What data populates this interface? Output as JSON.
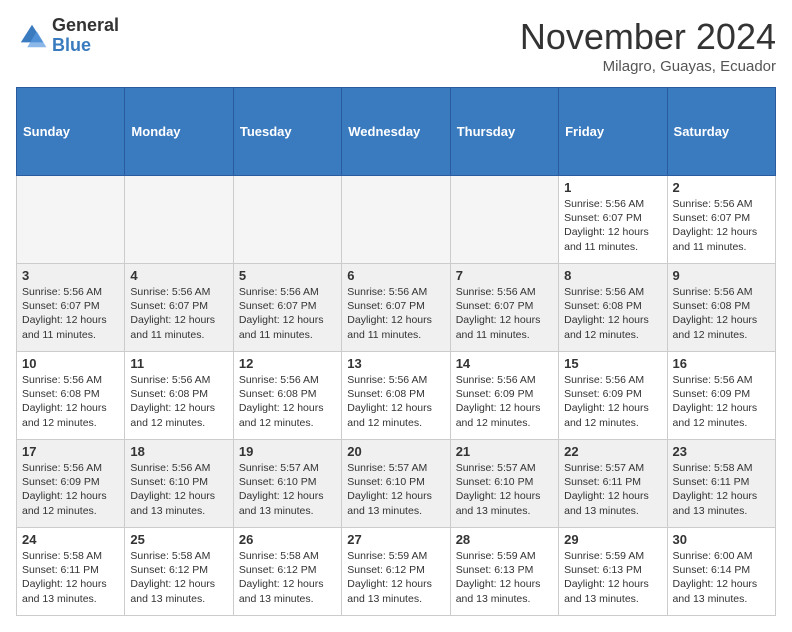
{
  "header": {
    "logo_general": "General",
    "logo_blue": "Blue",
    "month_title": "November 2024",
    "location": "Milagro, Guayas, Ecuador"
  },
  "weekdays": [
    "Sunday",
    "Monday",
    "Tuesday",
    "Wednesday",
    "Thursday",
    "Friday",
    "Saturday"
  ],
  "weeks": [
    [
      {
        "day": "",
        "info": ""
      },
      {
        "day": "",
        "info": ""
      },
      {
        "day": "",
        "info": ""
      },
      {
        "day": "",
        "info": ""
      },
      {
        "day": "",
        "info": ""
      },
      {
        "day": "1",
        "info": "Sunrise: 5:56 AM\nSunset: 6:07 PM\nDaylight: 12 hours\nand 11 minutes."
      },
      {
        "day": "2",
        "info": "Sunrise: 5:56 AM\nSunset: 6:07 PM\nDaylight: 12 hours\nand 11 minutes."
      }
    ],
    [
      {
        "day": "3",
        "info": "Sunrise: 5:56 AM\nSunset: 6:07 PM\nDaylight: 12 hours\nand 11 minutes."
      },
      {
        "day": "4",
        "info": "Sunrise: 5:56 AM\nSunset: 6:07 PM\nDaylight: 12 hours\nand 11 minutes."
      },
      {
        "day": "5",
        "info": "Sunrise: 5:56 AM\nSunset: 6:07 PM\nDaylight: 12 hours\nand 11 minutes."
      },
      {
        "day": "6",
        "info": "Sunrise: 5:56 AM\nSunset: 6:07 PM\nDaylight: 12 hours\nand 11 minutes."
      },
      {
        "day": "7",
        "info": "Sunrise: 5:56 AM\nSunset: 6:07 PM\nDaylight: 12 hours\nand 11 minutes."
      },
      {
        "day": "8",
        "info": "Sunrise: 5:56 AM\nSunset: 6:08 PM\nDaylight: 12 hours\nand 12 minutes."
      },
      {
        "day": "9",
        "info": "Sunrise: 5:56 AM\nSunset: 6:08 PM\nDaylight: 12 hours\nand 12 minutes."
      }
    ],
    [
      {
        "day": "10",
        "info": "Sunrise: 5:56 AM\nSunset: 6:08 PM\nDaylight: 12 hours\nand 12 minutes."
      },
      {
        "day": "11",
        "info": "Sunrise: 5:56 AM\nSunset: 6:08 PM\nDaylight: 12 hours\nand 12 minutes."
      },
      {
        "day": "12",
        "info": "Sunrise: 5:56 AM\nSunset: 6:08 PM\nDaylight: 12 hours\nand 12 minutes."
      },
      {
        "day": "13",
        "info": "Sunrise: 5:56 AM\nSunset: 6:08 PM\nDaylight: 12 hours\nand 12 minutes."
      },
      {
        "day": "14",
        "info": "Sunrise: 5:56 AM\nSunset: 6:09 PM\nDaylight: 12 hours\nand 12 minutes."
      },
      {
        "day": "15",
        "info": "Sunrise: 5:56 AM\nSunset: 6:09 PM\nDaylight: 12 hours\nand 12 minutes."
      },
      {
        "day": "16",
        "info": "Sunrise: 5:56 AM\nSunset: 6:09 PM\nDaylight: 12 hours\nand 12 minutes."
      }
    ],
    [
      {
        "day": "17",
        "info": "Sunrise: 5:56 AM\nSunset: 6:09 PM\nDaylight: 12 hours\nand 12 minutes."
      },
      {
        "day": "18",
        "info": "Sunrise: 5:56 AM\nSunset: 6:10 PM\nDaylight: 12 hours\nand 13 minutes."
      },
      {
        "day": "19",
        "info": "Sunrise: 5:57 AM\nSunset: 6:10 PM\nDaylight: 12 hours\nand 13 minutes."
      },
      {
        "day": "20",
        "info": "Sunrise: 5:57 AM\nSunset: 6:10 PM\nDaylight: 12 hours\nand 13 minutes."
      },
      {
        "day": "21",
        "info": "Sunrise: 5:57 AM\nSunset: 6:10 PM\nDaylight: 12 hours\nand 13 minutes."
      },
      {
        "day": "22",
        "info": "Sunrise: 5:57 AM\nSunset: 6:11 PM\nDaylight: 12 hours\nand 13 minutes."
      },
      {
        "day": "23",
        "info": "Sunrise: 5:58 AM\nSunset: 6:11 PM\nDaylight: 12 hours\nand 13 minutes."
      }
    ],
    [
      {
        "day": "24",
        "info": "Sunrise: 5:58 AM\nSunset: 6:11 PM\nDaylight: 12 hours\nand 13 minutes."
      },
      {
        "day": "25",
        "info": "Sunrise: 5:58 AM\nSunset: 6:12 PM\nDaylight: 12 hours\nand 13 minutes."
      },
      {
        "day": "26",
        "info": "Sunrise: 5:58 AM\nSunset: 6:12 PM\nDaylight: 12 hours\nand 13 minutes."
      },
      {
        "day": "27",
        "info": "Sunrise: 5:59 AM\nSunset: 6:12 PM\nDaylight: 12 hours\nand 13 minutes."
      },
      {
        "day": "28",
        "info": "Sunrise: 5:59 AM\nSunset: 6:13 PM\nDaylight: 12 hours\nand 13 minutes."
      },
      {
        "day": "29",
        "info": "Sunrise: 5:59 AM\nSunset: 6:13 PM\nDaylight: 12 hours\nand 13 minutes."
      },
      {
        "day": "30",
        "info": "Sunrise: 6:00 AM\nSunset: 6:14 PM\nDaylight: 12 hours\nand 13 minutes."
      }
    ]
  ]
}
